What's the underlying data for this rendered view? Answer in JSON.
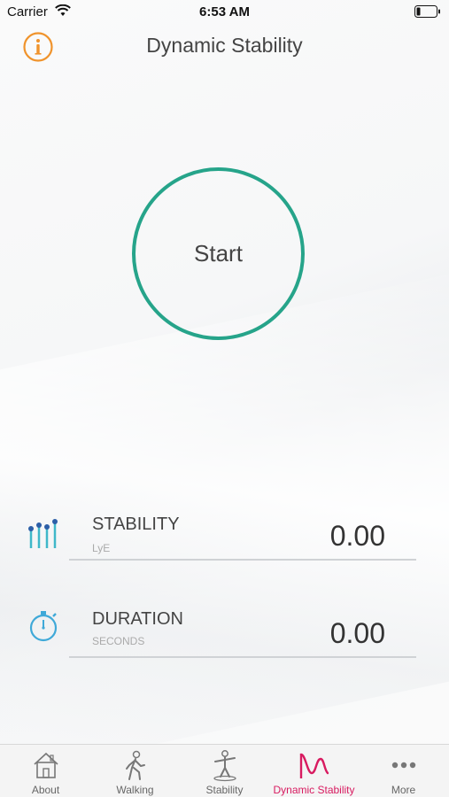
{
  "status_bar": {
    "carrier": "Carrier",
    "time": "6:53 AM"
  },
  "nav": {
    "title": "Dynamic Stability",
    "info_icon": "info-icon"
  },
  "start_button": {
    "label": "Start",
    "ring_color": "#26a48a"
  },
  "metrics": [
    {
      "label": "STABILITY",
      "unit": "LyE",
      "value": "0.00",
      "icon": "stability-bars-icon"
    },
    {
      "label": "DURATION",
      "unit": "SECONDS",
      "value": "0.00",
      "icon": "stopwatch-icon"
    }
  ],
  "tab_bar": {
    "active_color": "#d81b60",
    "items": [
      {
        "label": "About",
        "icon": "house-icon"
      },
      {
        "label": "Walking",
        "icon": "walking-person-icon"
      },
      {
        "label": "Stability",
        "icon": "balancing-person-icon"
      },
      {
        "label": "Dynamic Stability",
        "icon": "dynamic-stability-icon",
        "active": true
      },
      {
        "label": "More",
        "icon": "more-dots-icon"
      }
    ]
  }
}
